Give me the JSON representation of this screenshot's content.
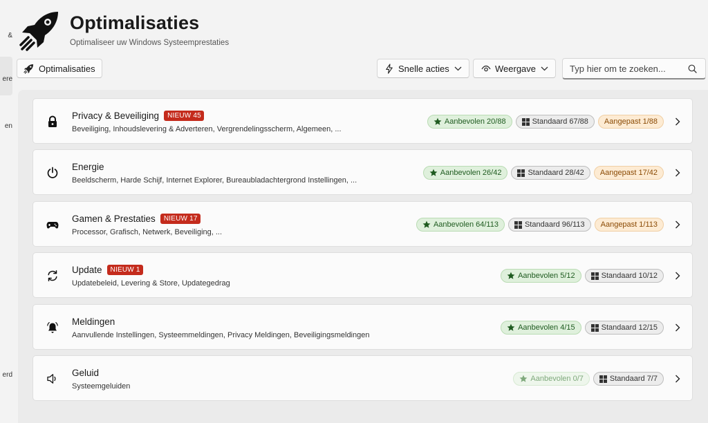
{
  "sidebar_fragments": [
    "&",
    "ere",
    "en",
    "erd"
  ],
  "header": {
    "title": "Optimalisaties",
    "subtitle": "Optimaliseer uw Windows Systeemprestaties",
    "icon": "rocket-icon"
  },
  "toolbar": {
    "optimalisaties_label": "Optimalisaties",
    "snelle_acties_label": "Snelle acties",
    "weergave_label": "Weergave",
    "search_placeholder": "Typ hier om te zoeken..."
  },
  "categories": [
    {
      "title": "Privacy & Beveiliging",
      "new_badge": "NIEUW 45",
      "icon": "lock-icon",
      "description": "Beveiliging, Inhoudslevering & Adverteren, Vergrendelingsscherm, Algemeen, ...",
      "recommended": "Aanbevolen 20/88",
      "standard": "Standaard 67/88",
      "custom": "Aangepast 1/88"
    },
    {
      "title": "Energie",
      "new_badge": "",
      "icon": "power-icon",
      "description": "Beeldscherm, Harde Schijf, Internet Explorer, Bureaubladachtergrond Instellingen, ...",
      "recommended": "Aanbevolen 26/42",
      "standard": "Standaard 28/42",
      "custom": "Aangepast 17/42"
    },
    {
      "title": "Gamen & Prestaties",
      "new_badge": "NIEUW 17",
      "icon": "gamepad-icon",
      "description": "Processor, Grafisch, Netwerk, Beveiliging, ...",
      "recommended": "Aanbevolen 64/113",
      "standard": "Standaard 96/113",
      "custom": "Aangepast 1/113"
    },
    {
      "title": "Update",
      "new_badge": "NIEUW 1",
      "icon": "sync-icon",
      "description": "Updatebeleid, Levering & Store, Updategedrag",
      "recommended": "Aanbevolen 5/12",
      "standard": "Standaard 10/12",
      "custom": ""
    },
    {
      "title": "Meldingen",
      "new_badge": "",
      "icon": "bell-icon",
      "description": "Aanvullende Instellingen, Systeemmeldingen, Privacy Meldingen, Beveiligingsmeldingen",
      "recommended": "Aanbevolen 4/15",
      "standard": "Standaard 12/15",
      "custom": ""
    },
    {
      "title": "Geluid",
      "new_badge": "",
      "icon": "speaker-icon",
      "description": "Systeemgeluiden",
      "recommended": "Aanbevolen 0/7",
      "standard": "Standaard 7/7",
      "custom": ""
    }
  ],
  "colors": {
    "new_badge": "#c42b1c",
    "recommended": "#1f5b20",
    "custom": "#8a4a04"
  }
}
